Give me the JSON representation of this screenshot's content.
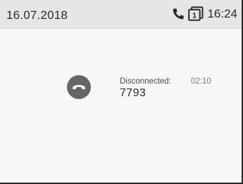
{
  "status_bar": {
    "date": "16.07.2018",
    "time": "16:24",
    "icons": [
      "phone-icon",
      "line-one-icon"
    ],
    "line_number": "1"
  },
  "call": {
    "status_label": "Disconnected:",
    "duration": "02:10",
    "number": "7793",
    "button_icon": "hangup-icon"
  },
  "colors": {
    "status_bar_bg": "#e6e6e6",
    "screen_bg": "#f7f7f7",
    "hangup_button": "#666666"
  }
}
